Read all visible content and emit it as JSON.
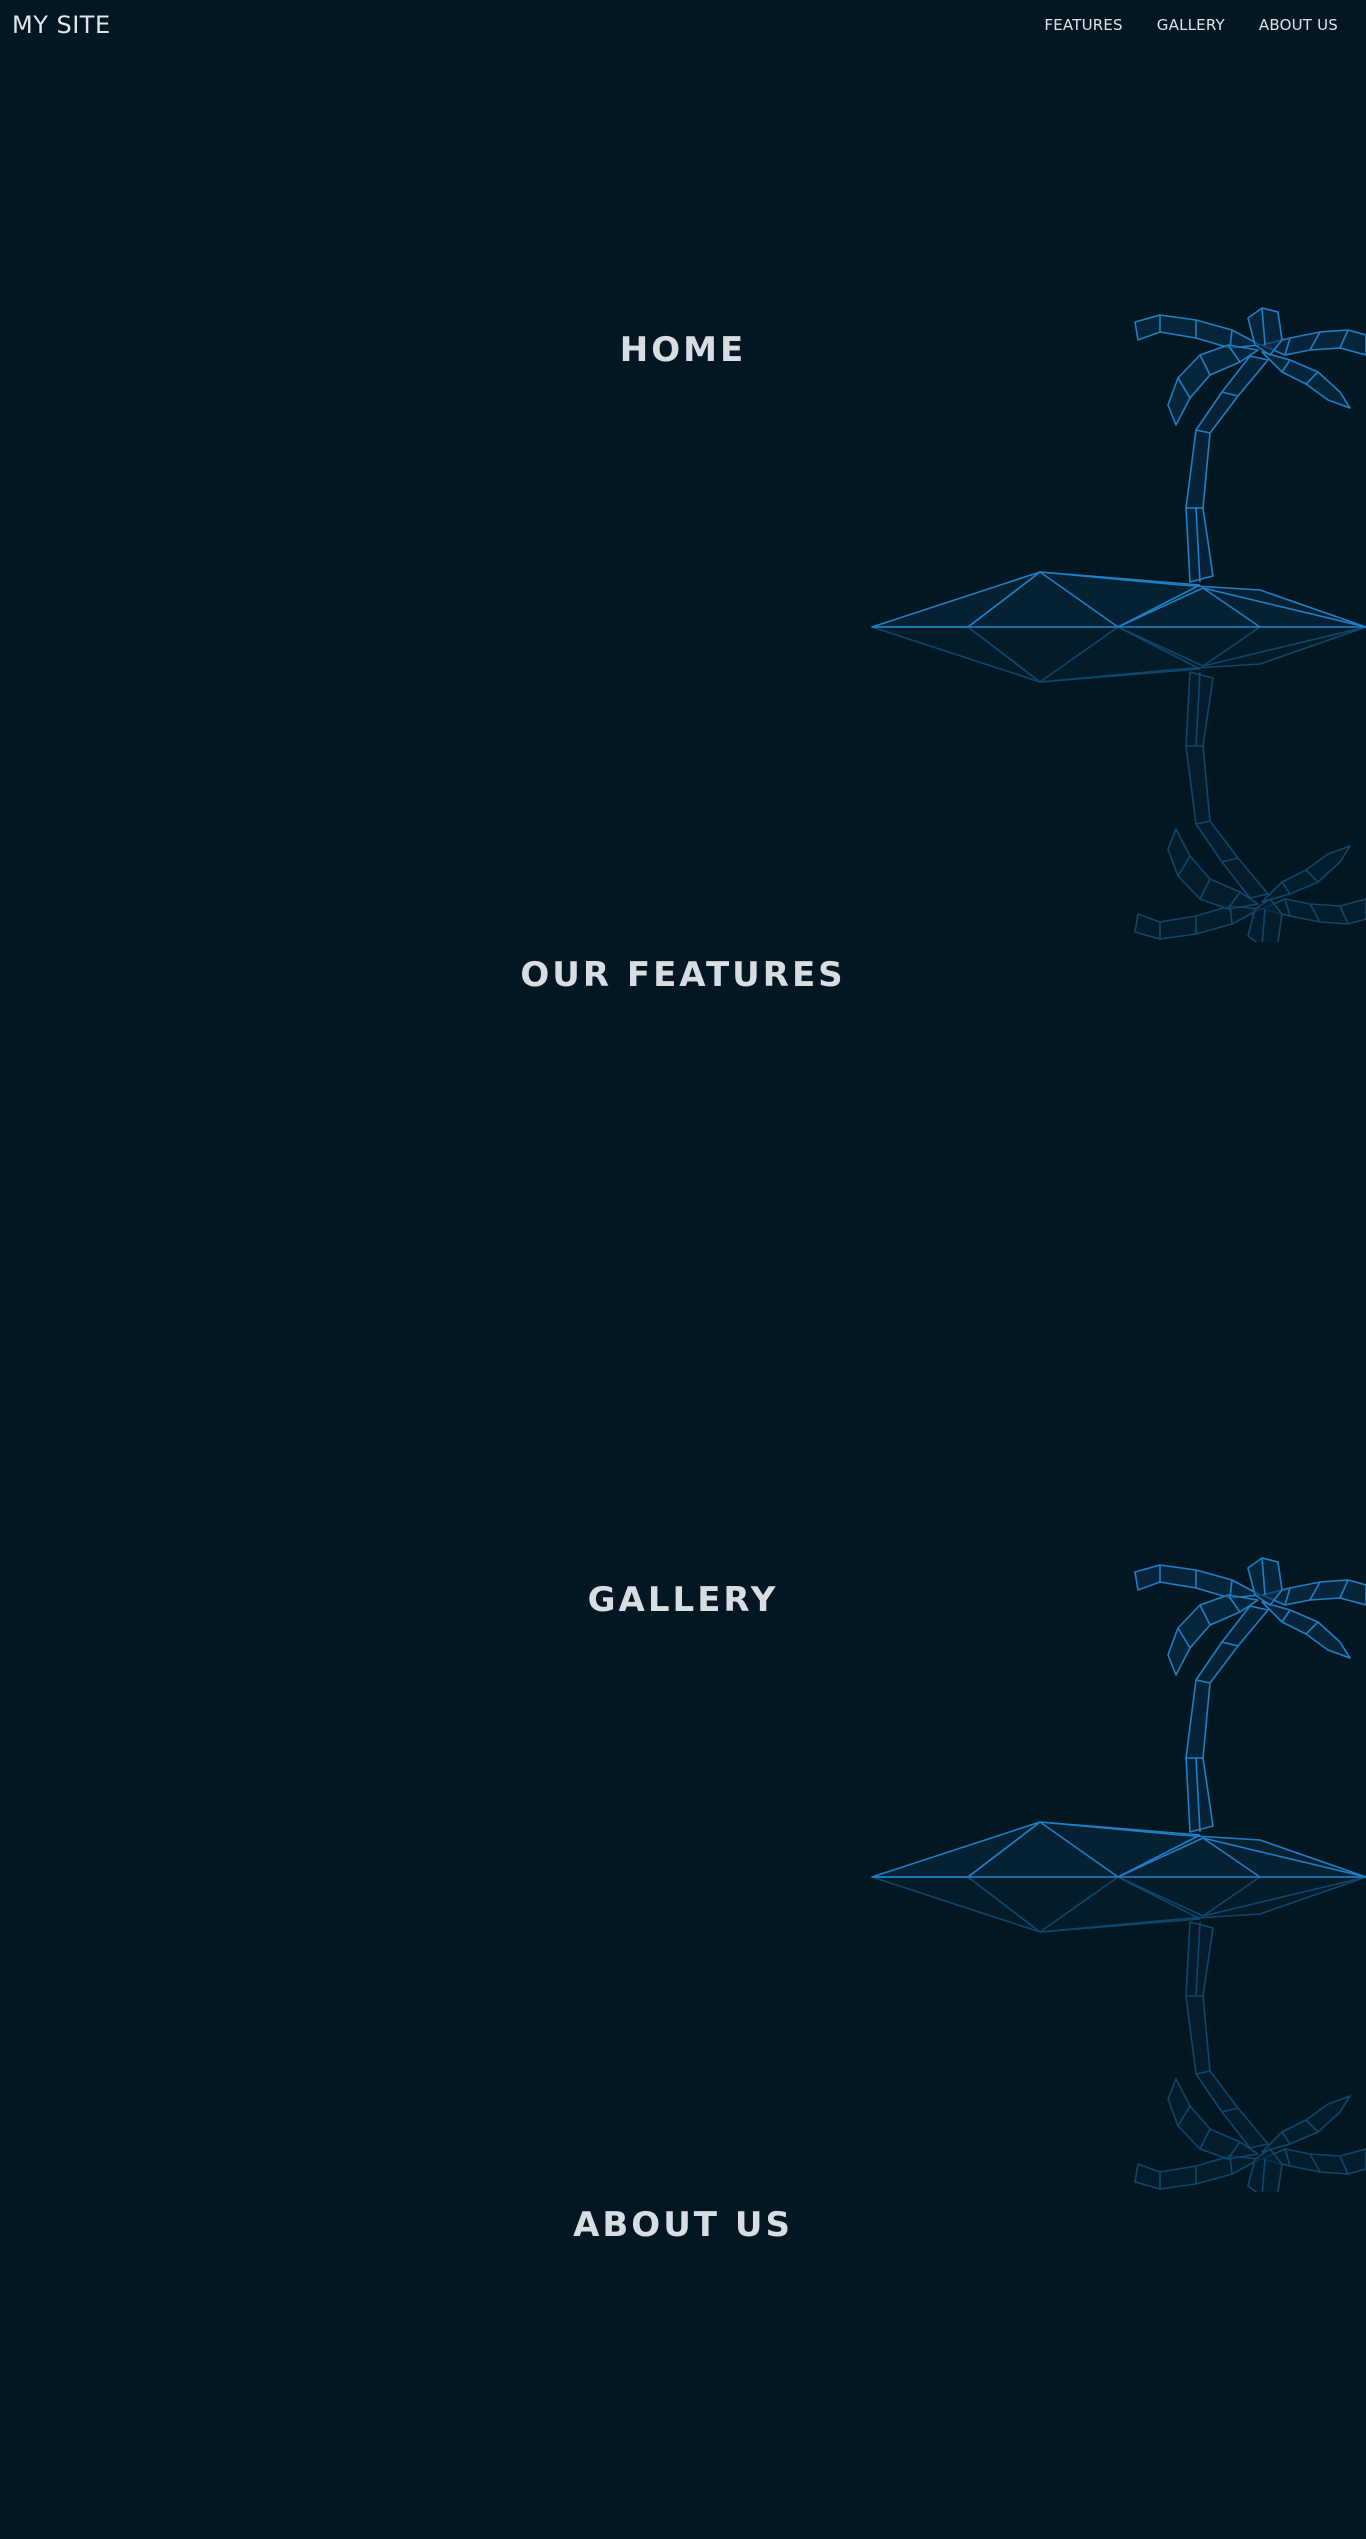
{
  "site": {
    "brand": "MY SITE"
  },
  "nav": {
    "links": [
      "FEATURES",
      "GALLERY",
      "ABOUT US"
    ]
  },
  "sections": {
    "home": "HOME",
    "features": "OUR FEATURES",
    "gallery": "GALLERY",
    "about": "ABOUT US"
  },
  "colors": {
    "background": "#031723",
    "wireframe": "#1f7fc4",
    "text": "#d8dde2"
  },
  "icons": {
    "island": "low-poly-palm-island-icon"
  }
}
